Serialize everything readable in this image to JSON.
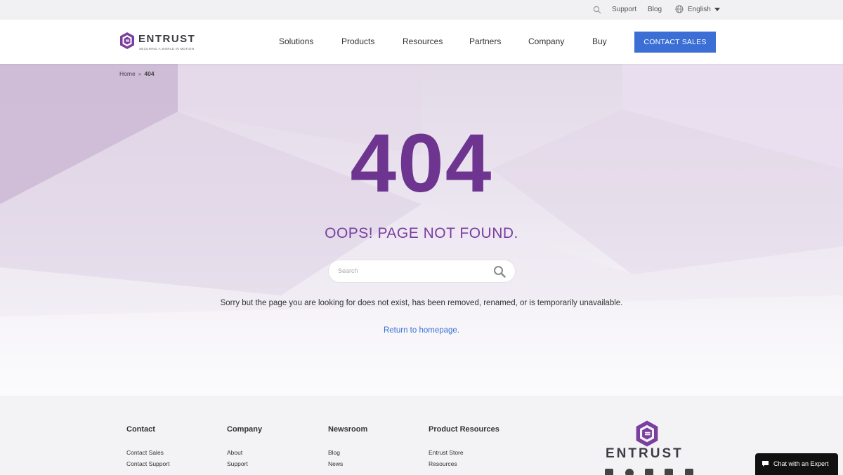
{
  "utility": {
    "support": "Support",
    "blog": "Blog",
    "language": "English"
  },
  "nav": {
    "logo_word": "ENTRUST",
    "logo_tagline": "SECURING A WORLD IN MOTION",
    "items": [
      "Solutions",
      "Products",
      "Resources",
      "Partners",
      "Company",
      "Buy"
    ],
    "cta": "CONTACT SALES"
  },
  "hero": {
    "breadcrumb": {
      "home": "Home",
      "separator": "»",
      "current": "404"
    },
    "code": "404",
    "heading": "OOPS! PAGE NOT FOUND.",
    "search_placeholder": "Search",
    "message": "Sorry but the page you are looking for does not exist, has been removed, renamed, or is temporarily unavailable.",
    "return_link": "Return to homepage."
  },
  "footer": {
    "columns": [
      {
        "title": "Contact",
        "links": [
          "Contact Sales",
          "Contact Support"
        ]
      },
      {
        "title": "Company",
        "links": [
          "About",
          "Support"
        ]
      },
      {
        "title": "Newsroom",
        "links": [
          "Blog",
          "News"
        ]
      },
      {
        "title": "Product Resources",
        "links": [
          "Entrust Store",
          "Resources"
        ]
      }
    ],
    "logo_word": "ENTRUST",
    "social": [
      "twitter-icon",
      "facebook-icon",
      "instagram-icon",
      "linkedin-icon",
      "youtube-icon"
    ]
  },
  "chat": {
    "label": "Chat with an Expert"
  },
  "colors": {
    "brand_purple": "#6d3590",
    "cta_blue": "#3b6fd6",
    "link_blue": "#3b6fd6"
  }
}
